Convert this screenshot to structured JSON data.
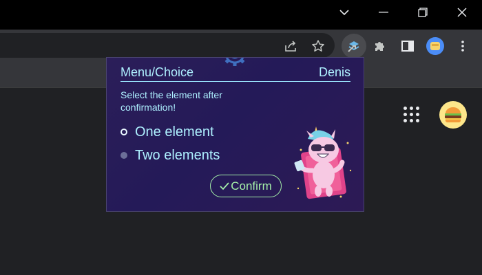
{
  "window": {
    "controls": [
      "chevron-down-icon",
      "minimize-icon",
      "restore-icon",
      "close-icon"
    ]
  },
  "toolbar": {
    "icons": [
      "share-icon",
      "star-icon",
      "extension-active-icon",
      "puzzle-icon",
      "sidepanel-icon",
      "profile-avatar-icon",
      "more-vert-icon"
    ]
  },
  "popup": {
    "title": "Menu/Choice",
    "user": "Denis",
    "prompt": "Select the element after confirmation!",
    "options": [
      {
        "label": "One element",
        "selected": true
      },
      {
        "label": "Two elements",
        "selected": false
      }
    ],
    "confirm_label": "Confirm",
    "colors": {
      "text": "#aef0ff",
      "confirm": "#a5f0a9",
      "background": "#2b1e59"
    }
  }
}
